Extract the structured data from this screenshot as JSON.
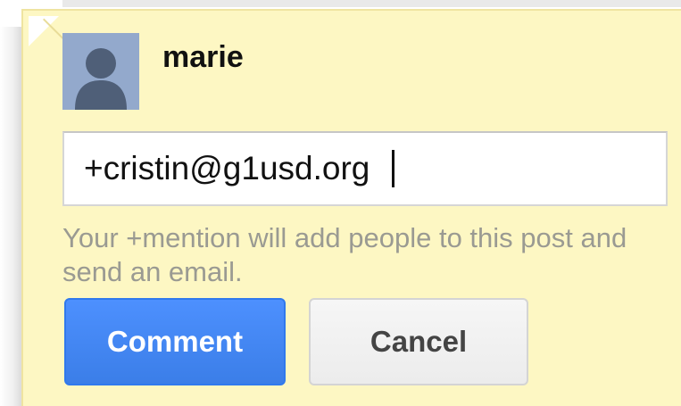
{
  "author": {
    "name": "marie",
    "avatar_icon": "default-profile-silhouette-icon"
  },
  "comment_box": {
    "value": "+cristin@g1usd.org "
  },
  "helper": {
    "text": "Your +mention will add people to this post and send an email."
  },
  "actions": {
    "comment_label": "Comment",
    "cancel_label": "Cancel"
  },
  "colors": {
    "card_background": "#fdf7c3",
    "primary_button": "#4d90fe",
    "secondary_button": "#f1f1f1",
    "helper_text": "#9a9a92"
  }
}
